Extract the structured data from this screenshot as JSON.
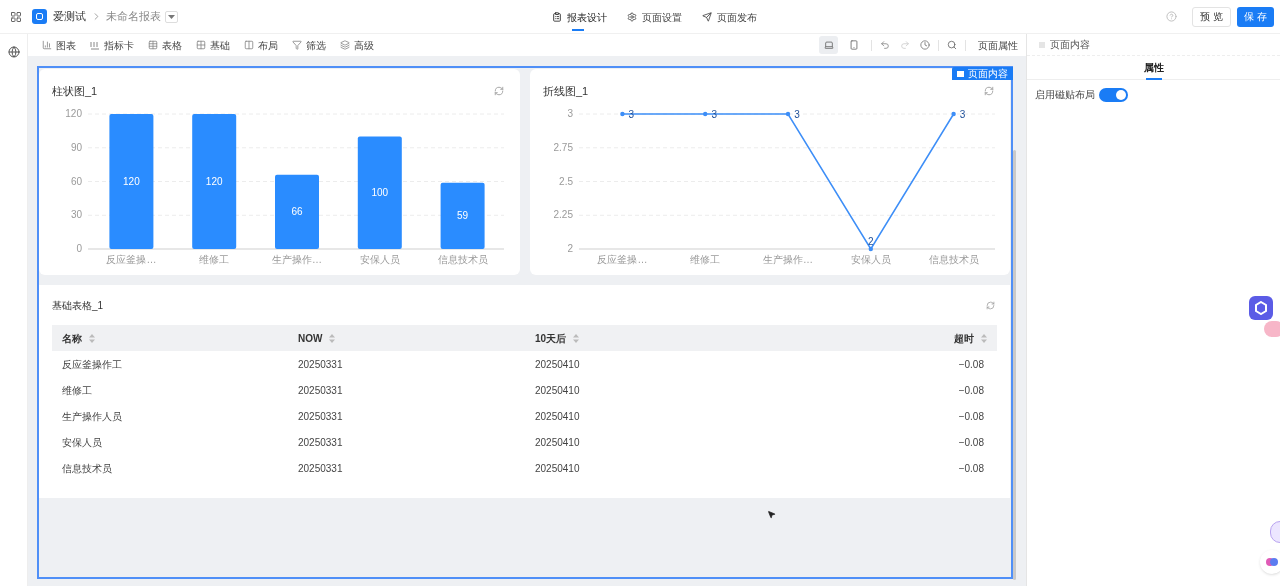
{
  "app": {
    "name": "爱测试",
    "report_name": "未命名报表"
  },
  "top_tabs": [
    {
      "label": "报表设计",
      "kind": "design",
      "selected": true
    },
    {
      "label": "页面设置",
      "kind": "settings",
      "selected": false
    },
    {
      "label": "页面发布",
      "kind": "publish",
      "selected": false
    }
  ],
  "header_buttons": [
    {
      "label": "预 览",
      "kind": "secondary"
    },
    {
      "label": "保 存",
      "kind": "primary"
    }
  ],
  "toolbar": {
    "items": [
      {
        "label": "图表",
        "kind": "chart"
      },
      {
        "label": "指标卡",
        "kind": "number"
      },
      {
        "label": "表格",
        "kind": "table"
      },
      {
        "label": "基础",
        "kind": "grid"
      },
      {
        "label": "布局",
        "kind": "columns"
      },
      {
        "label": "筛选",
        "kind": "filter"
      },
      {
        "label": "高级",
        "kind": "layers"
      }
    ],
    "devices": [
      {
        "kind": "desktop",
        "selected": true
      },
      {
        "kind": "mobile",
        "selected": false
      }
    ],
    "page_properties": "页面属性"
  },
  "canvas": {
    "badge": "页面内容",
    "bar_chart": {
      "title": "柱状图_1",
      "chart_data": {
        "type": "bar",
        "categories": [
          "反应釜操…",
          "维修工",
          "生产操作…",
          "安保人员",
          "信息技术员"
        ],
        "series": [
          {
            "color": "#2a8cff",
            "values": [
              120,
              120,
              66,
              100,
              59
            ]
          }
        ],
        "ylim": [
          0,
          120
        ],
        "yticks": [
          0,
          30,
          60,
          90,
          120
        ],
        "data_labels": true,
        "grid": true
      }
    },
    "line_chart": {
      "title": "折线图_1",
      "chart_data": {
        "type": "line",
        "categories": [
          "反应釜操…",
          "维修工",
          "生产操作…",
          "安保人员",
          "信息技术员"
        ],
        "series": [
          {
            "color": "#3d8ef7",
            "values": [
              3,
              3,
              3,
              2,
              3
            ]
          }
        ],
        "ylim": [
          2,
          3
        ],
        "yticks": [
          2,
          2.25,
          2.5,
          2.75,
          3
        ],
        "data_labels": true,
        "grid": true
      }
    },
    "table": {
      "title": "基础表格_1",
      "columns": [
        "名称",
        "NOW",
        "10天后",
        "超时"
      ],
      "rows": [
        [
          "反应釜操作工",
          "20250331",
          "20250410",
          "−0.08"
        ],
        [
          "维修工",
          "20250331",
          "20250410",
          "−0.08"
        ],
        [
          "生产操作人员",
          "20250331",
          "20250410",
          "−0.08"
        ],
        [
          "安保人员",
          "20250331",
          "20250410",
          "−0.08"
        ],
        [
          "信息技术员",
          "20250331",
          "20250410",
          "−0.08"
        ]
      ]
    }
  },
  "right_panel": {
    "breadcrumb": "页面内容",
    "tabs": [
      {
        "label": "属性",
        "selected": true
      }
    ],
    "settings": [
      {
        "label": "启用磁贴布局",
        "on": true
      }
    ]
  }
}
